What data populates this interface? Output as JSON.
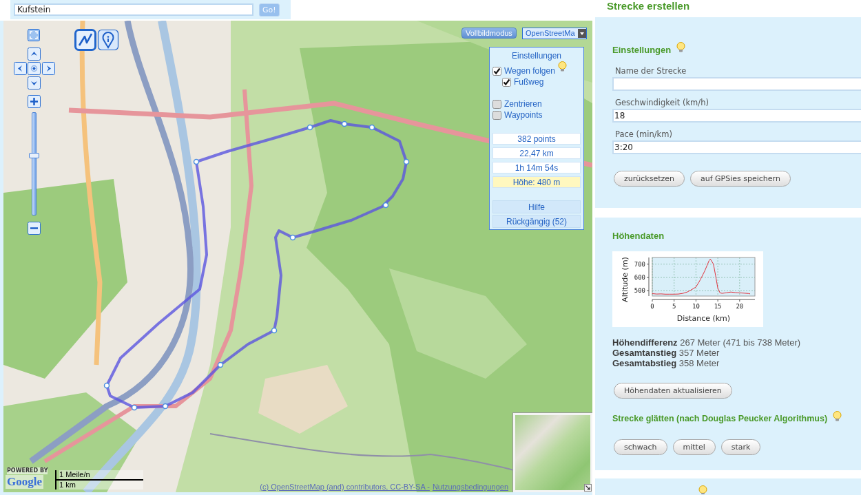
{
  "search": {
    "value": "Kufstein",
    "button": "Go!"
  },
  "map": {
    "tools": [
      {
        "kind": "route",
        "selected": true
      },
      {
        "kind": "marker",
        "selected": false
      }
    ],
    "zoom": {
      "level": 0.59
    },
    "fullscreen_button": "Vollbildmodus",
    "layer_select": {
      "value": "OpenStreetMa"
    },
    "settings": {
      "title": "Einstellungen",
      "groups": [
        {
          "options": [
            {
              "label": "Wegen folgen",
              "checked": true,
              "hint": true,
              "children": [
                {
                  "label": "Fußweg",
                  "checked": true,
                  "hint": false
                }
              ]
            }
          ]
        },
        {
          "options": [
            {
              "label": "Zentrieren",
              "checked": false,
              "hint": false
            },
            {
              "label": "Waypoints",
              "checked": false,
              "hint": false
            }
          ]
        }
      ],
      "stats": [
        {
          "text": "382 points",
          "highlighted": false
        },
        {
          "text": "22,47 km",
          "highlighted": false
        },
        {
          "text": "1h 14m 54s",
          "highlighted": false
        },
        {
          "text": "Höhe: 480 m",
          "highlighted": true
        }
      ],
      "buttons": [
        "Hilfe",
        "Rückgängig (52)"
      ]
    },
    "scale": {
      "top": "1 Meile/n",
      "bottom": "1 km"
    },
    "logo": {
      "caption": "POWERED BY",
      "name": "Google"
    },
    "attribution": {
      "text": "(c) OpenStreetMap (and) contributors, CC-BY-SA -",
      "link": "Nutzungsbedingungen"
    }
  },
  "panel": {
    "title": "Strecke erstellen",
    "settings_card": {
      "heading": "Einstellungen",
      "hint": true,
      "fields": [
        {
          "label": "Name der Strecke"
        },
        {
          "label": "Geschwindigkeit (km/h)",
          "value": "18"
        },
        {
          "label": "Pace (min/km)",
          "value": "3:20"
        }
      ],
      "buttons": [
        "zurücksetzen",
        "auf GPSies speichern"
      ]
    },
    "elevation_card": {
      "heading": "Höhendaten",
      "chart_data": {
        "type": "line",
        "xlabel": "Distance (km)",
        "ylabel": "Altitude (m)",
        "x": [
          0,
          1,
          2,
          3,
          4,
          5,
          6,
          7,
          8,
          9,
          10,
          11,
          12,
          13,
          13.3,
          14,
          14.5,
          15,
          15.5,
          16,
          17,
          18,
          19,
          20,
          21,
          22,
          22.4
        ],
        "values": [
          478,
          475,
          476,
          474,
          474,
          474,
          475,
          480,
          490,
          508,
          528,
          582,
          648,
          726,
          738,
          700,
          614,
          519,
          484,
          480,
          485,
          490,
          486,
          484,
          482,
          479,
          476
        ],
        "xlim": [
          0,
          23.5
        ],
        "ylim": [
          460,
          750
        ],
        "xticks": [
          0,
          5,
          10,
          15,
          20
        ],
        "yticks": [
          500,
          600,
          700
        ],
        "grid": true
      },
      "stats": [
        "**Höhendifferenz** 267 Meter (471 bis 738 Meter)",
        "**Gesamtanstieg** 357 Meter",
        "**Gesamtabstieg** 358 Meter"
      ],
      "update_button": "Höhendaten aktualisieren",
      "smoothing": {
        "heading": "Strecke glätten (nach Douglas Peucker Algorithmus)",
        "hint": true,
        "buttons": [
          "schwach",
          "mittel",
          "stark"
        ]
      }
    },
    "next_card": {
      "hint": true
    }
  }
}
